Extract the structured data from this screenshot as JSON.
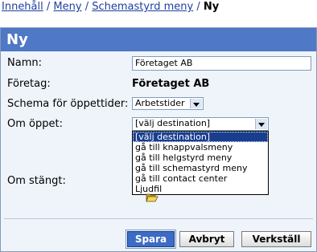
{
  "breadcrumb": {
    "items": [
      "Innehåll",
      "Meny",
      "Schemastyrd meny"
    ],
    "separator": "/",
    "current": "Ny"
  },
  "panel": {
    "title": "Ny"
  },
  "form": {
    "name_label": "Namn:",
    "name_value": "Företaget AB",
    "company_label": "Företag:",
    "company_value": "Företaget AB",
    "schedule_label": "Schema för öppettider:",
    "schedule_value": "Arbetstider",
    "open_label": "Om öppet:",
    "open_value": "[välj destination]",
    "open_options": [
      "[välj destination]",
      "gå till knappvalsmeny",
      "gå till helgstyrd meny",
      "gå till schemastyrd meny",
      "gå till contact center",
      "Ljudfil"
    ],
    "closed_label": "Om stängt:"
  },
  "buttons": {
    "save": "Spara",
    "cancel": "Avbryt",
    "apply": "Verkställ"
  },
  "colors": {
    "title_bar": "#4f78c6",
    "panel_bg": "#eff4fb",
    "link": "#1f3f9f",
    "selection": "#1a3e8f"
  }
}
